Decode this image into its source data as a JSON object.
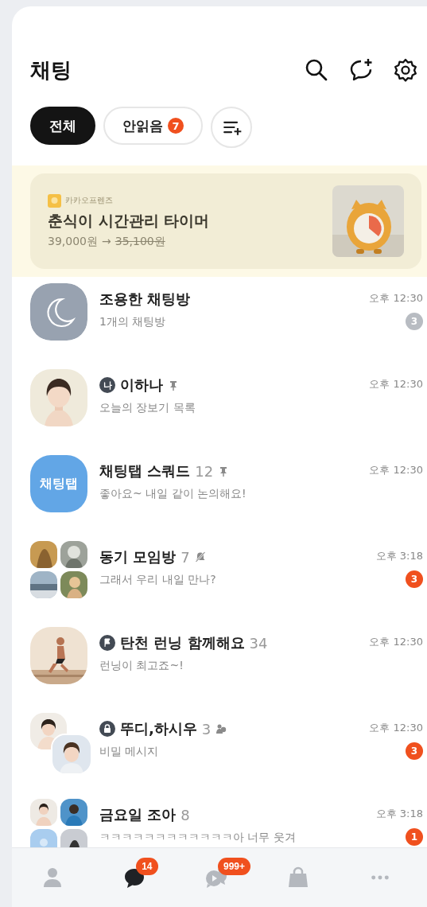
{
  "header": {
    "title": "채팅"
  },
  "filters": [
    {
      "label": "전체",
      "selected": true
    },
    {
      "label": "안읽음",
      "badge": "7",
      "selected": false
    }
  ],
  "ad": {
    "brand": "카카오프렌즈",
    "title": "춘식이 시간관리 타이머",
    "price": "39,000원",
    "arrow": "→",
    "struck_price": "35,100원"
  },
  "chats": [
    {
      "avatar": {
        "kind": "moon"
      },
      "name": "조용한 채팅방",
      "pinned": false,
      "muted": false,
      "members_icon": false,
      "message": "1개의 채팅방",
      "time": "오후 12:30",
      "unread": {
        "count": "3",
        "muted": true
      }
    },
    {
      "avatar": {
        "kind": "portrait"
      },
      "tag": {
        "kind": "me",
        "text": "나"
      },
      "name": "이하나",
      "pinned": true,
      "muted": false,
      "members_icon": false,
      "message": "오늘의 장보기 목록",
      "time": "오후 12:30"
    },
    {
      "avatar": {
        "kind": "text",
        "text": "채팅탭"
      },
      "name": "채팅탭 스쿼드",
      "count": "12",
      "pinned": true,
      "muted": false,
      "members_icon": false,
      "message": "좋아요~ 내일 같이 논의해요!",
      "time": "오후 12:30"
    },
    {
      "avatar": {
        "kind": "group"
      },
      "name": "동기 모임방",
      "count": "7",
      "pinned": false,
      "muted": true,
      "members_icon": false,
      "message": "그래서 우리 내일 만나?",
      "time": "오후 3:18",
      "unread": {
        "count": "3",
        "muted": false
      }
    },
    {
      "avatar": {
        "kind": "runner"
      },
      "tag": {
        "kind": "flag"
      },
      "name": "탄천 런닝 함께해요",
      "count": "34",
      "pinned": false,
      "muted": false,
      "members_icon": false,
      "message": "런닝이 최고죠~!",
      "time": "오후 12:30"
    },
    {
      "avatar": {
        "kind": "pair"
      },
      "tag": {
        "kind": "lock"
      },
      "name": "뚜디,하시우",
      "count": "3",
      "pinned": false,
      "muted": false,
      "members_icon": true,
      "message": "비밀 메시지",
      "time": "오후 12:30",
      "unread": {
        "count": "3",
        "muted": false
      }
    },
    {
      "avatar": {
        "kind": "group"
      },
      "name": "금요일 조아",
      "count": "8",
      "pinned": false,
      "muted": false,
      "members_icon": false,
      "message": "ㅋㅋㅋㅋㅋㅋㅋㅋㅋㅋㅋㅋ아 너무 웃겨",
      "time": "오후 3:18",
      "unread": {
        "count": "1",
        "muted": false
      }
    }
  ],
  "nav": [
    {
      "kind": "person",
      "selected": false
    },
    {
      "kind": "chat",
      "badge": "14",
      "selected": true
    },
    {
      "kind": "openchat",
      "badge": "999+",
      "selected": false
    },
    {
      "kind": "shopping",
      "selected": false
    },
    {
      "kind": "more",
      "selected": false
    }
  ]
}
